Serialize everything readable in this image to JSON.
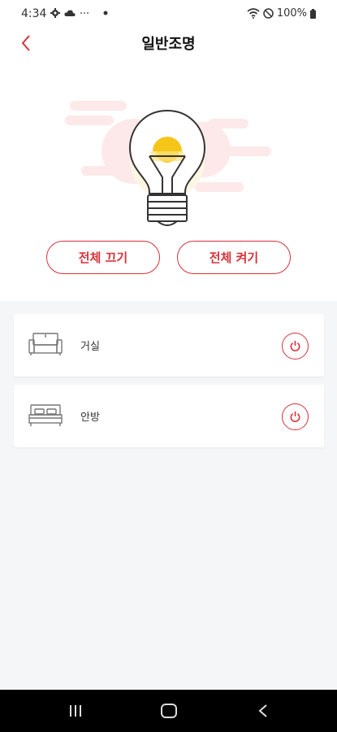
{
  "status_bar": {
    "time": "4:34",
    "battery_text": "100%",
    "icons": [
      "gear-icon",
      "cloud-icon",
      "dots-icon",
      "wifi-icon",
      "do-not-disturb-icon",
      "battery-icon"
    ]
  },
  "header": {
    "title": "일반조명",
    "back_icon": "chevron-left-icon"
  },
  "controls": {
    "all_off_label": "전체 끄기",
    "all_on_label": "전체 켜기"
  },
  "rooms": [
    {
      "label": "거실",
      "icon": "sofa-icon",
      "power_icon": "power-icon"
    },
    {
      "label": "안방",
      "icon": "bed-icon",
      "power_icon": "power-icon"
    }
  ],
  "colors": {
    "accent": "#d6333a",
    "bulb_glow": "#f5c518",
    "background": "#f5f6f8"
  }
}
